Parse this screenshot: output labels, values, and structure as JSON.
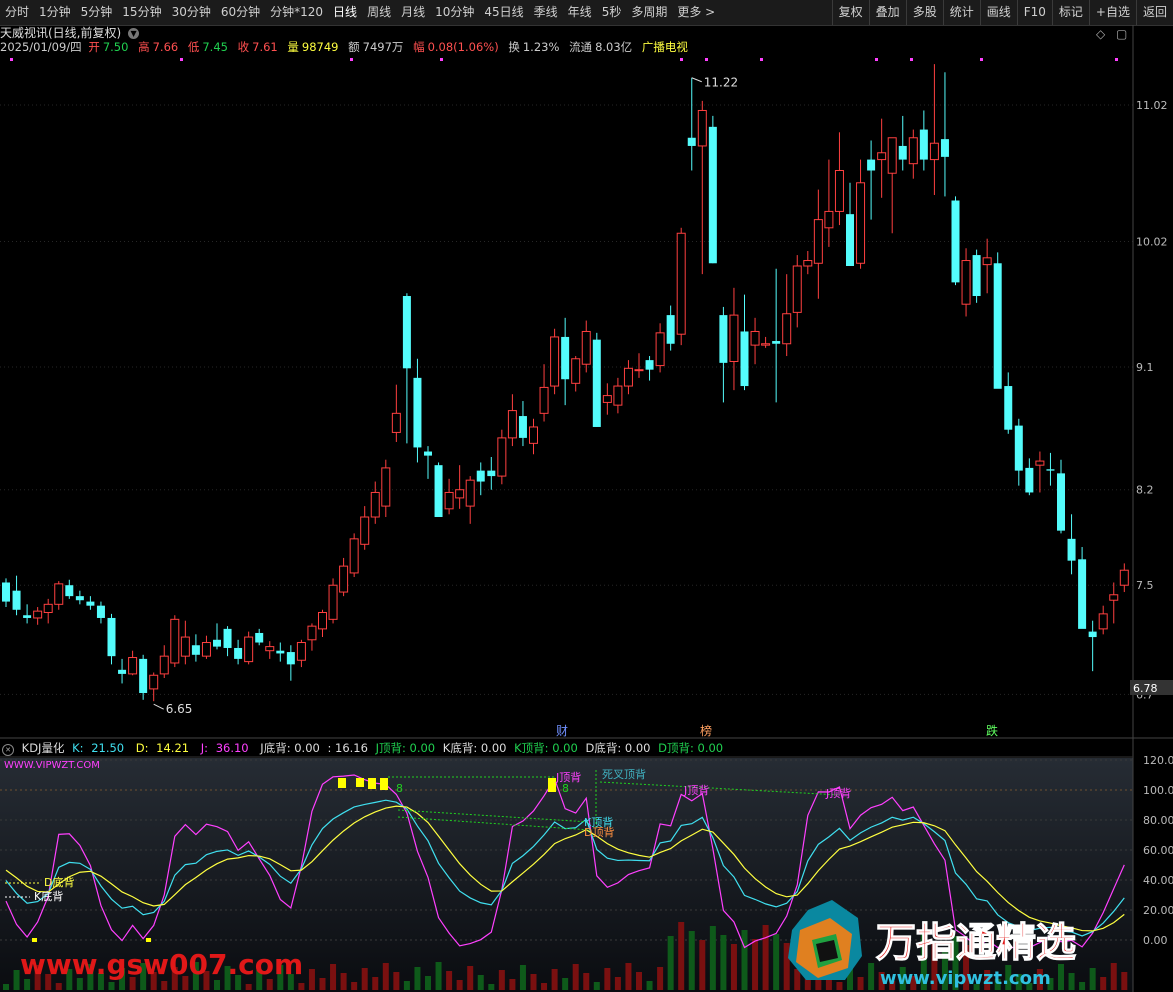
{
  "toolbar": {
    "left_items": [
      "分时",
      "1分钟",
      "5分钟",
      "15分钟",
      "30分钟",
      "60分钟",
      "分钟*120",
      "日线",
      "周线",
      "月线",
      "10分钟",
      "45日线",
      "季线",
      "年线",
      "5秒",
      "多周期",
      "更多 >"
    ],
    "active_item": "日线",
    "right_items": [
      "复权",
      "叠加",
      "多股",
      "统计",
      "画线",
      "F10",
      "标记",
      "+自选",
      "返回"
    ]
  },
  "stock": {
    "name": "天威视讯(日线,前复权)",
    "date": "2025/01/09/四",
    "open_label": "开",
    "open": "7.50",
    "high_label": "高",
    "high": "7.66",
    "low_label": "低",
    "low": "7.45",
    "close_label": "收",
    "close": "7.61",
    "volume_label": "量",
    "volume": "98749",
    "amount_label": "额",
    "amount": "7497万",
    "change_label": "幅",
    "change": "0.08(1.06%)",
    "turnover_label": "换",
    "turnover": "1.23%",
    "float_label": "流通",
    "float": "8.03亿",
    "concept": "广播电视"
  },
  "price_axis": {
    "labels": [
      "11.02",
      "10.02",
      "9.1",
      "8.2",
      "7.5",
      "6.7"
    ],
    "current_price_tag": "6.78"
  },
  "annotations": {
    "high_label": "11.22",
    "low_label": "6.65",
    "event_labels": [
      "财",
      "榜",
      "跌"
    ]
  },
  "kdj": {
    "name": "KDJ量化",
    "k_label": "K:",
    "k": "21.50",
    "d_label": "D:",
    "d": "14.21",
    "j_label": "J:",
    "j": "36.10",
    "j_bottom": "J底背: 0.00",
    "extra": ": 16.16",
    "j_top": "J顶背: 0.00",
    "k_bottom": "K底背: 0.00",
    "k_top": "K顶背: 0.00",
    "d_bottom": "D底背: 0.00",
    "d_top": "D顶背: 0.00",
    "site_label": "WWW.VIPWZT.COM",
    "axis_labels": [
      "120.00",
      "100.00",
      "80.00",
      "60.00",
      "40.00",
      "20.00",
      "0.00"
    ],
    "signals": {
      "d_bottom": "D底背",
      "k_bottom": "K底背",
      "j_top_a": "J顶背",
      "k_top": "K顶背",
      "d_top": "D顶背",
      "dead_cross": "死叉顶背",
      "j_top_b": "J顶背",
      "j_top_c": "J顶背",
      "count_a": "8",
      "count_b": "8"
    }
  },
  "watermarks": {
    "left": "www.gsw007.com",
    "brand": "万指通精选",
    "brand_url": "www.vipwzt.com"
  },
  "colors": {
    "up": "#ff4040",
    "down": "#54fcfc",
    "k_line": "#40e0f0",
    "d_line": "#ffff40",
    "j_line": "#ff40ff",
    "brand_red": "#e01818"
  },
  "chart_data": {
    "type": "candlestick",
    "ylim": [
      6.6,
      11.35
    ],
    "candles": [
      [
        7.52,
        7.55,
        7.34,
        7.38
      ],
      [
        7.46,
        7.57,
        7.28,
        7.32
      ],
      [
        7.28,
        7.36,
        7.22,
        7.26
      ],
      [
        7.26,
        7.34,
        7.21,
        7.31
      ],
      [
        7.3,
        7.4,
        7.22,
        7.36
      ],
      [
        7.36,
        7.53,
        7.32,
        7.51
      ],
      [
        7.5,
        7.54,
        7.4,
        7.42
      ],
      [
        7.42,
        7.46,
        7.36,
        7.39
      ],
      [
        7.38,
        7.42,
        7.32,
        7.35
      ],
      [
        7.35,
        7.38,
        7.22,
        7.26
      ],
      [
        7.26,
        7.29,
        6.92,
        6.98
      ],
      [
        6.88,
        6.96,
        6.78,
        6.85
      ],
      [
        6.85,
        7.02,
        6.84,
        6.97
      ],
      [
        6.96,
        6.99,
        6.66,
        6.71
      ],
      [
        6.74,
        6.86,
        6.65,
        6.84
      ],
      [
        6.85,
        7.06,
        6.82,
        6.98
      ],
      [
        6.93,
        7.28,
        6.9,
        7.25
      ],
      [
        6.98,
        7.24,
        6.92,
        7.12
      ],
      [
        7.06,
        7.14,
        6.94,
        6.99
      ],
      [
        6.98,
        7.13,
        6.96,
        7.08
      ],
      [
        7.1,
        7.22,
        7.03,
        7.05
      ],
      [
        7.18,
        7.2,
        6.98,
        7.04
      ],
      [
        7.04,
        7.1,
        6.92,
        6.96
      ],
      [
        6.94,
        7.16,
        6.92,
        7.12
      ],
      [
        7.15,
        7.18,
        7.06,
        7.08
      ],
      [
        7.02,
        7.09,
        6.96,
        7.05
      ],
      [
        7.02,
        7.08,
        6.94,
        7.0
      ],
      [
        7.01,
        7.06,
        6.8,
        6.92
      ],
      [
        6.95,
        7.1,
        6.9,
        7.08
      ],
      [
        7.1,
        7.22,
        7.02,
        7.2
      ],
      [
        7.18,
        7.32,
        7.12,
        7.3
      ],
      [
        7.25,
        7.55,
        7.22,
        7.5
      ],
      [
        7.45,
        7.7,
        7.42,
        7.64
      ],
      [
        7.59,
        7.88,
        7.56,
        7.84
      ],
      [
        7.8,
        8.08,
        7.76,
        8.0
      ],
      [
        8.0,
        8.26,
        7.95,
        8.18
      ],
      [
        8.08,
        8.42,
        8.0,
        8.36
      ],
      [
        8.62,
        8.97,
        8.55,
        8.76
      ],
      [
        9.62,
        9.64,
        8.54,
        9.09
      ],
      [
        9.02,
        9.16,
        8.4,
        8.51
      ],
      [
        8.48,
        8.52,
        8.28,
        8.45
      ],
      [
        8.38,
        8.4,
        8.0,
        8.0
      ],
      [
        8.06,
        8.28,
        8.02,
        8.18
      ],
      [
        8.14,
        8.38,
        8.06,
        8.2
      ],
      [
        8.08,
        8.3,
        7.95,
        8.27
      ],
      [
        8.34,
        8.4,
        8.16,
        8.26
      ],
      [
        8.34,
        8.44,
        8.2,
        8.3
      ],
      [
        8.3,
        8.64,
        8.24,
        8.58
      ],
      [
        8.58,
        8.9,
        8.52,
        8.78
      ],
      [
        8.74,
        8.85,
        8.52,
        8.58
      ],
      [
        8.54,
        8.72,
        8.46,
        8.66
      ],
      [
        8.76,
        9.12,
        8.7,
        8.95
      ],
      [
        8.96,
        9.38,
        8.9,
        9.32
      ],
      [
        9.32,
        9.46,
        8.82,
        9.01
      ],
      [
        8.98,
        9.18,
        8.92,
        9.16
      ],
      [
        9.12,
        9.44,
        9.06,
        9.36
      ],
      [
        9.3,
        9.35,
        8.66,
        8.66
      ],
      [
        8.84,
        8.98,
        8.75,
        8.89
      ],
      [
        8.82,
        9.02,
        8.76,
        8.96
      ],
      [
        8.96,
        9.15,
        8.9,
        9.09
      ],
      [
        9.08,
        9.2,
        9.02,
        9.08
      ],
      [
        9.15,
        9.18,
        9.0,
        9.08
      ],
      [
        9.11,
        9.42,
        9.06,
        9.35
      ],
      [
        9.48,
        9.55,
        9.22,
        9.27
      ],
      [
        9.34,
        10.12,
        9.26,
        10.08
      ],
      [
        10.78,
        11.22,
        10.54,
        10.72
      ],
      [
        10.72,
        11.05,
        9.78,
        10.98
      ],
      [
        10.86,
        10.94,
        9.86,
        9.86
      ],
      [
        9.48,
        9.54,
        8.84,
        9.13
      ],
      [
        9.14,
        9.68,
        8.93,
        9.48
      ],
      [
        9.36,
        9.63,
        8.93,
        8.96
      ],
      [
        9.26,
        9.46,
        9.12,
        9.36
      ],
      [
        9.26,
        9.32,
        9.24,
        9.27
      ],
      [
        9.29,
        9.82,
        8.84,
        9.27
      ],
      [
        9.27,
        9.78,
        9.18,
        9.49
      ],
      [
        9.5,
        9.92,
        9.39,
        9.84
      ],
      [
        9.84,
        9.95,
        9.78,
        9.88
      ],
      [
        9.86,
        10.4,
        9.6,
        10.18
      ],
      [
        10.12,
        10.62,
        9.98,
        10.24
      ],
      [
        10.24,
        10.82,
        10.14,
        10.54
      ],
      [
        10.22,
        10.45,
        9.84,
        9.84
      ],
      [
        9.86,
        10.62,
        9.82,
        10.45
      ],
      [
        10.62,
        10.76,
        10.18,
        10.54
      ],
      [
        10.62,
        10.92,
        10.34,
        10.67
      ],
      [
        10.52,
        10.74,
        10.08,
        10.78
      ],
      [
        10.72,
        10.94,
        10.54,
        10.62
      ],
      [
        10.59,
        10.84,
        10.48,
        10.78
      ],
      [
        10.84,
        10.98,
        10.54,
        10.62
      ],
      [
        10.62,
        11.32,
        10.36,
        10.74
      ],
      [
        10.77,
        11.26,
        10.35,
        10.64
      ],
      [
        10.32,
        10.35,
        9.7,
        9.72
      ],
      [
        9.56,
        9.97,
        9.47,
        9.88
      ],
      [
        9.92,
        9.96,
        9.57,
        9.62
      ],
      [
        9.85,
        10.04,
        9.64,
        9.9
      ],
      [
        9.86,
        9.94,
        8.98,
        8.94
      ],
      [
        8.96,
        9.06,
        8.61,
        8.64
      ],
      [
        8.67,
        8.72,
        8.23,
        8.34
      ],
      [
        8.36,
        8.43,
        8.16,
        8.18
      ],
      [
        8.38,
        8.48,
        8.18,
        8.41
      ],
      [
        8.35,
        8.47,
        8.23,
        8.34
      ],
      [
        8.32,
        8.42,
        7.88,
        7.9
      ],
      [
        7.84,
        8.02,
        7.58,
        7.68
      ],
      [
        7.69,
        7.78,
        7.25,
        7.18
      ],
      [
        7.16,
        7.24,
        6.87,
        7.12
      ],
      [
        7.18,
        7.35,
        7.14,
        7.29
      ],
      [
        7.39,
        7.52,
        7.22,
        7.43
      ],
      [
        7.5,
        7.66,
        7.45,
        7.61
      ]
    ]
  }
}
